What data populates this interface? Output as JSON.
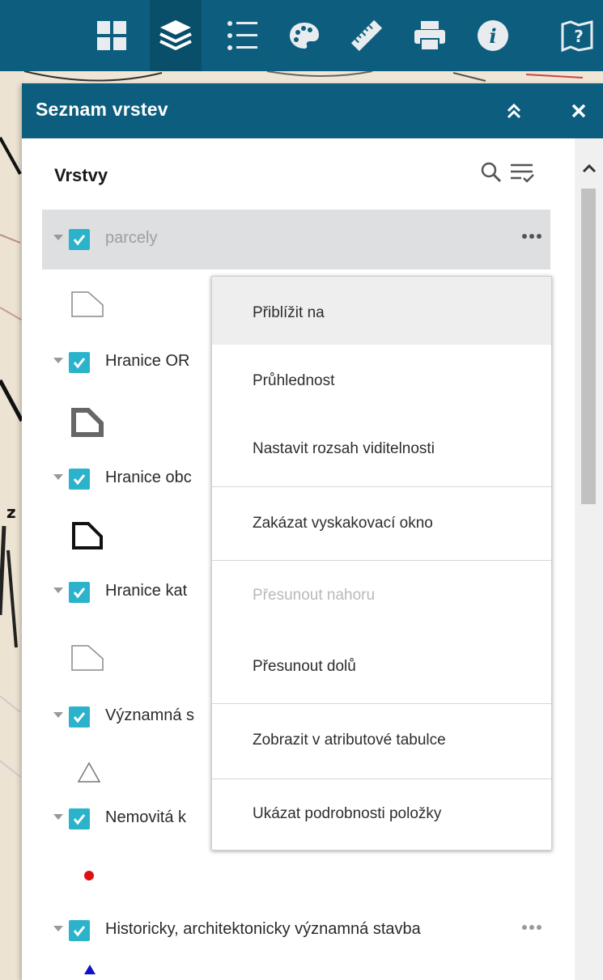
{
  "toolbar": {
    "tools": [
      {
        "name": "basemap-gallery"
      },
      {
        "name": "layer-list",
        "active": true
      },
      {
        "name": "legend"
      },
      {
        "name": "theme-analysis"
      },
      {
        "name": "measurement"
      },
      {
        "name": "print"
      },
      {
        "name": "about"
      },
      {
        "name": "help"
      }
    ]
  },
  "panel": {
    "title": "Seznam vrstev",
    "heading": "Vrstvy",
    "layers": [
      {
        "label": "parcely",
        "legend_symbol": "polygon-thin-gray",
        "selected": true
      },
      {
        "label": "Hranice OR",
        "legend_symbol": "polygon-thick-gray"
      },
      {
        "label": "Hranice obc",
        "legend_symbol": "polygon-thick-black"
      },
      {
        "label": "Hranice kat",
        "legend_symbol": "polygon-thin-gray"
      },
      {
        "label": "Významná s",
        "legend_symbol": "triangle-outline-gray"
      },
      {
        "label": "Nemovitá k",
        "legend_symbol": "dot-red"
      },
      {
        "label": "Historicky, architektonicky významná stavba",
        "legend_symbol": "triangle-blue"
      }
    ]
  },
  "context_menu": {
    "items": [
      {
        "label": "Přiblížit na",
        "state": "hover"
      },
      {
        "label": "Průhlednost"
      },
      {
        "label": "Nastavit rozsah viditelnosti"
      },
      {
        "label": "Zakázat vyskakovací okno"
      },
      {
        "label": "Přesunout nahoru",
        "state": "disabled"
      },
      {
        "label": "Přesunout dolů"
      },
      {
        "label": "Zobrazit v atributové tabulce"
      },
      {
        "label": "Ukázat podrobnosti položky"
      }
    ]
  },
  "colors": {
    "header": "#0d5e7e",
    "checkbox": "#2bb3cc",
    "selected_row": "#dddfe1",
    "menu_hover": "#eeeeee"
  }
}
